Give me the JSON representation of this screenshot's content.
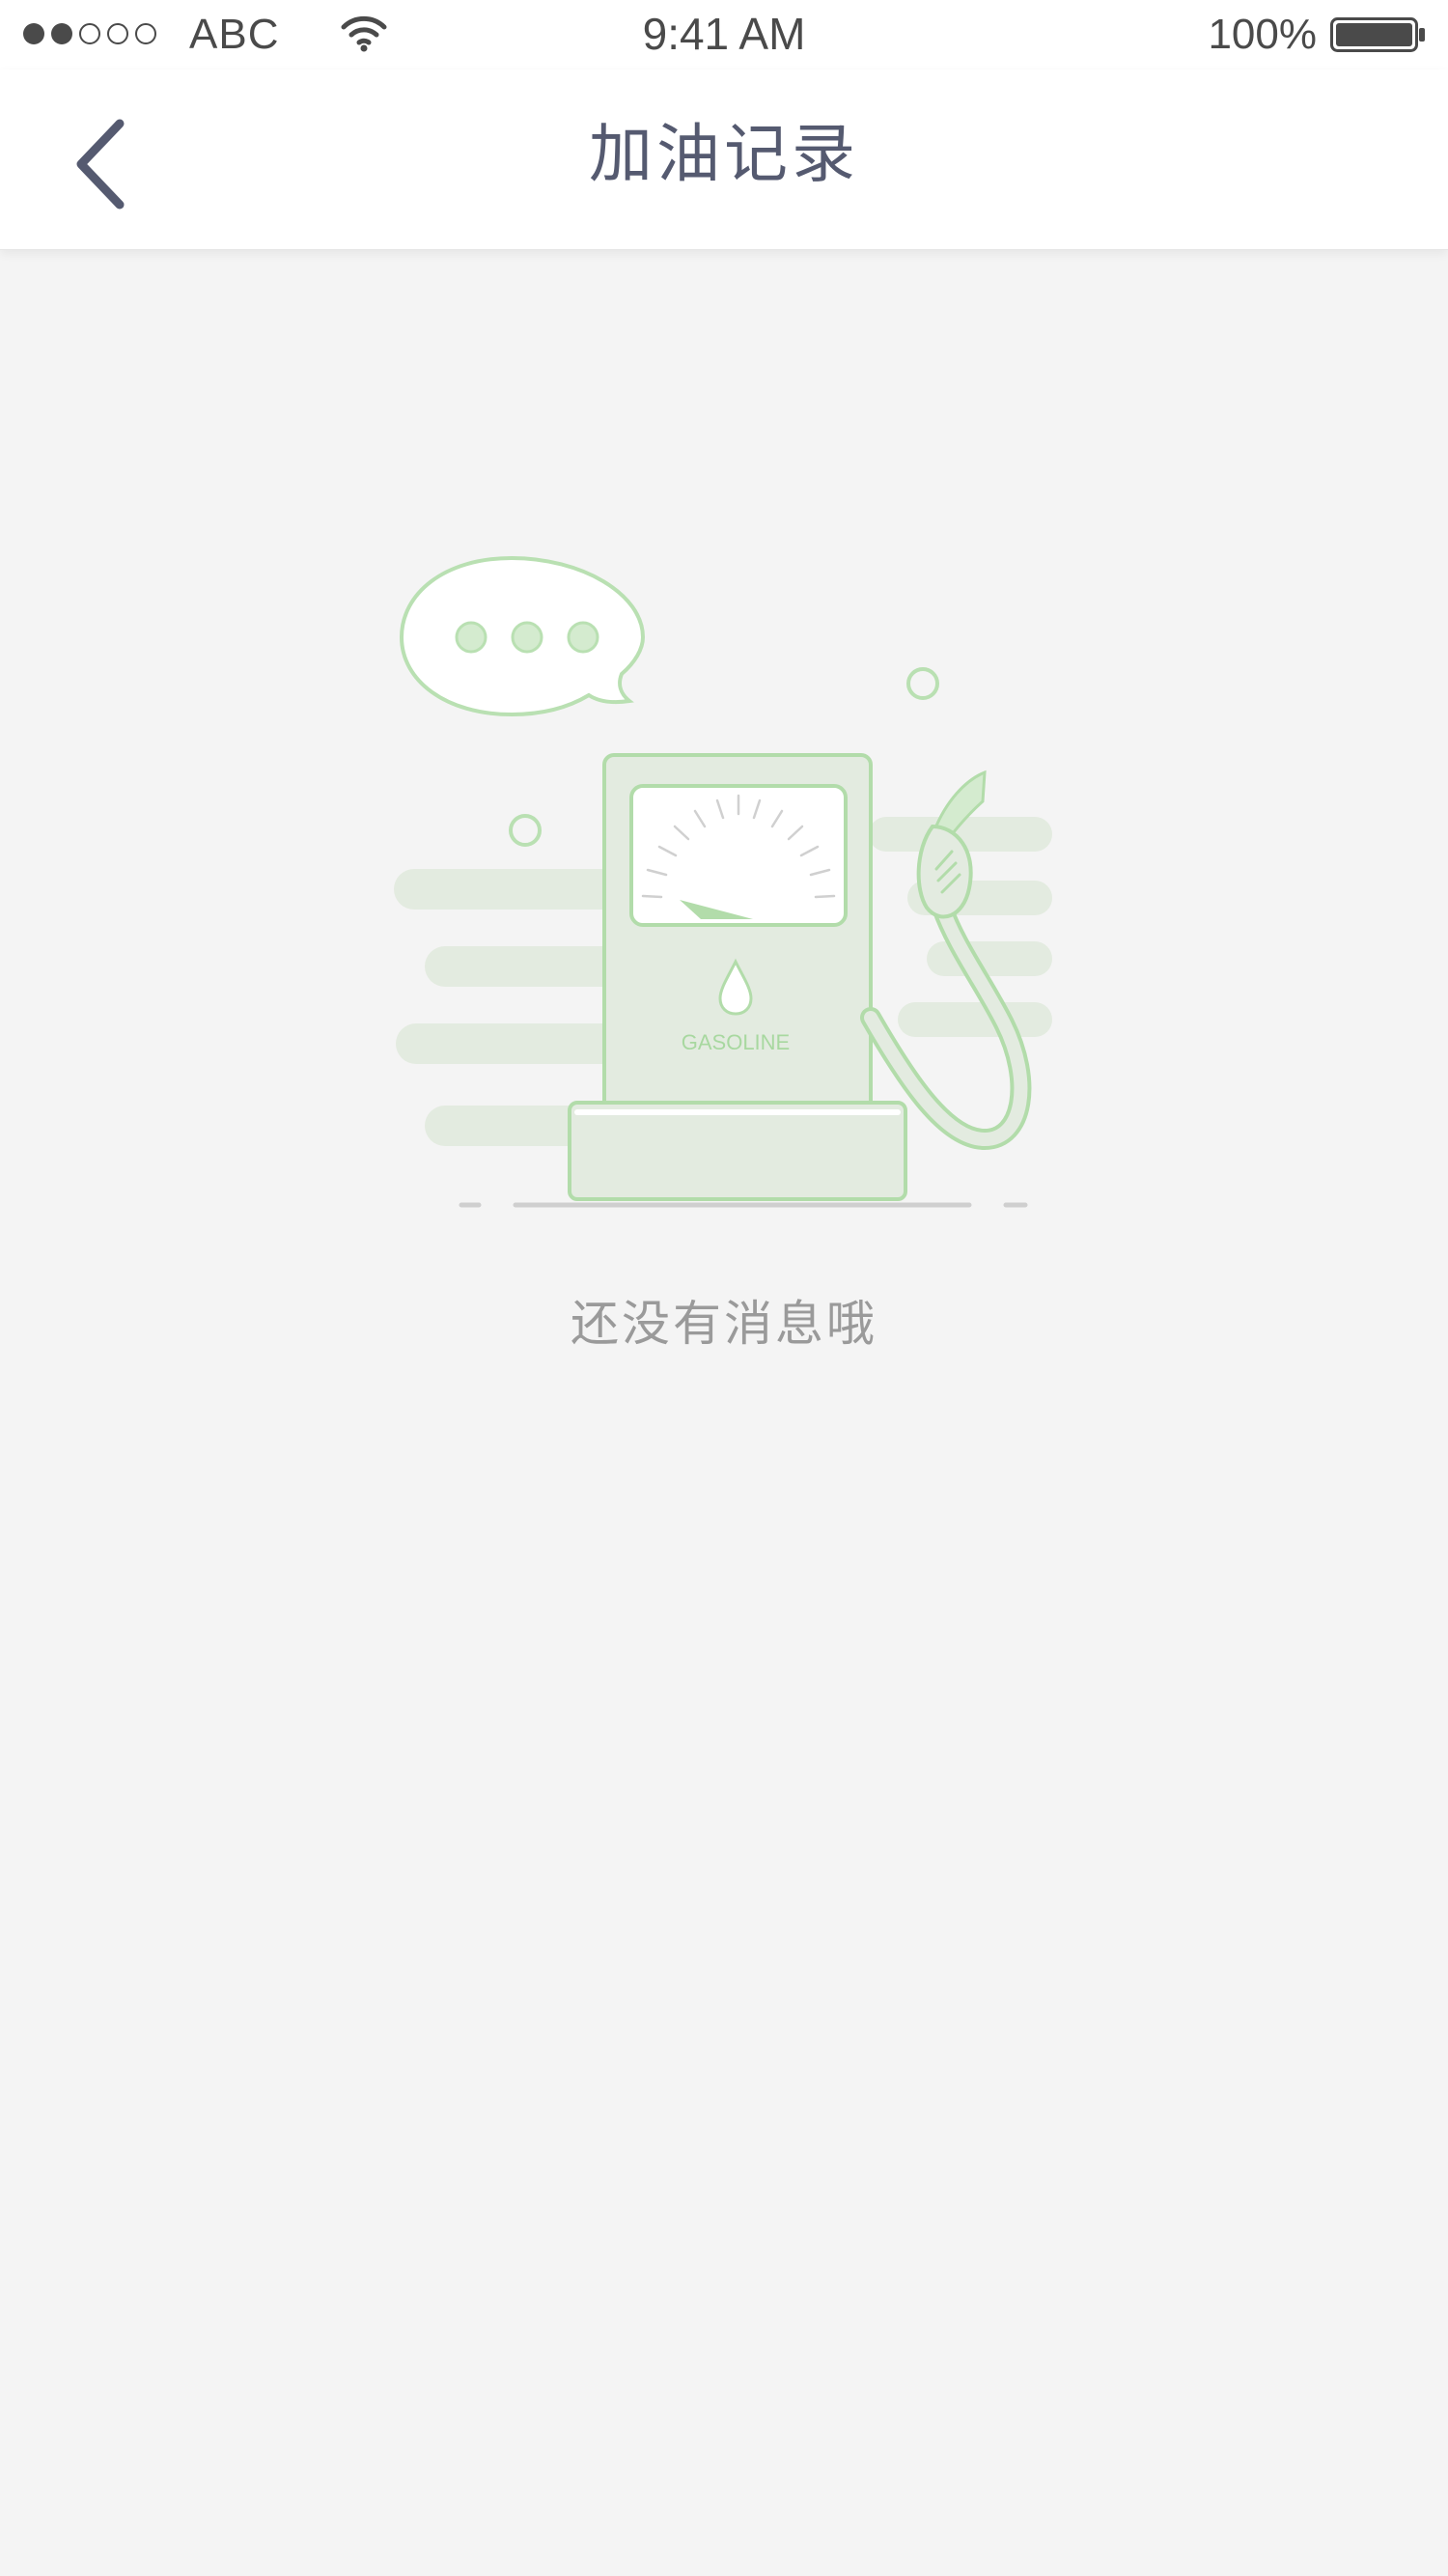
{
  "status_bar": {
    "carrier": "ABC",
    "time": "9:41 AM",
    "battery_percent": "100%",
    "signal_bars_filled": 2,
    "signal_bars_total": 5
  },
  "nav_bar": {
    "title": "加油记录",
    "back_icon": "chevron-left-icon"
  },
  "empty_state": {
    "illustration_label": "GASOLINE",
    "message": "还没有消息哦",
    "illustration_icon": "gas-pump-icon"
  },
  "colors": {
    "background": "#f4f4f4",
    "nav_text": "#555a70",
    "illustration_green": "#a8d8a0",
    "illustration_fill": "#e3ebe0",
    "muted_text": "#9a9a9a"
  }
}
